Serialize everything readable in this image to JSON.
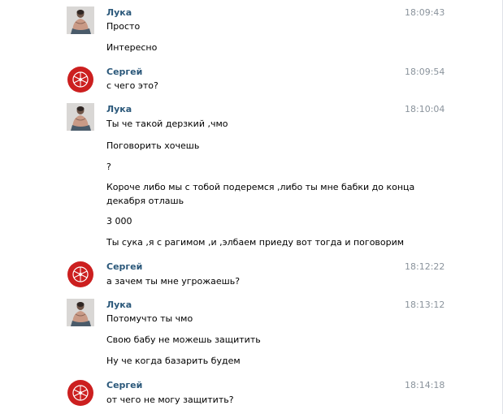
{
  "messages": [
    {
      "author": "Лука",
      "avatar": "user-photo",
      "time": "18:09:43",
      "lines": [
        "Просто",
        "Интересно"
      ]
    },
    {
      "author": "Сергей",
      "avatar": "red-logo",
      "time": "18:09:54",
      "lines": [
        "с чего это?"
      ]
    },
    {
      "author": "Лука",
      "avatar": "user-photo",
      "time": "18:10:04",
      "lines": [
        "Ты че такой дерзкий ,чмо",
        "Поговорить хочешь",
        "?",
        "Короче либо мы с тобой подеремся ,либо ты мне бабки до конца",
        "декабря отлашь",
        "3 000",
        "Ты сука ,я с рагимом ,и ,элбаем приеду вот тогда и поговорим"
      ]
    },
    {
      "author": "Сергей",
      "avatar": "red-logo",
      "time": "18:12:22",
      "lines": [
        "а зачем ты мне угрожаешь?"
      ]
    },
    {
      "author": "Лука",
      "avatar": "user-photo",
      "time": "18:13:12",
      "lines": [
        "Потомучто ты чмо",
        "Свою бабу не можешь защитить",
        "Ну че когда базарить будем"
      ]
    },
    {
      "author": "Сергей",
      "avatar": "red-logo",
      "time": "18:14:18",
      "lines": [
        "от чего не могу защитить?"
      ]
    }
  ],
  "colors": {
    "author": "#2b587a",
    "time": "#8a939c",
    "text": "#000000",
    "logo_red": "#cc1f1f"
  }
}
